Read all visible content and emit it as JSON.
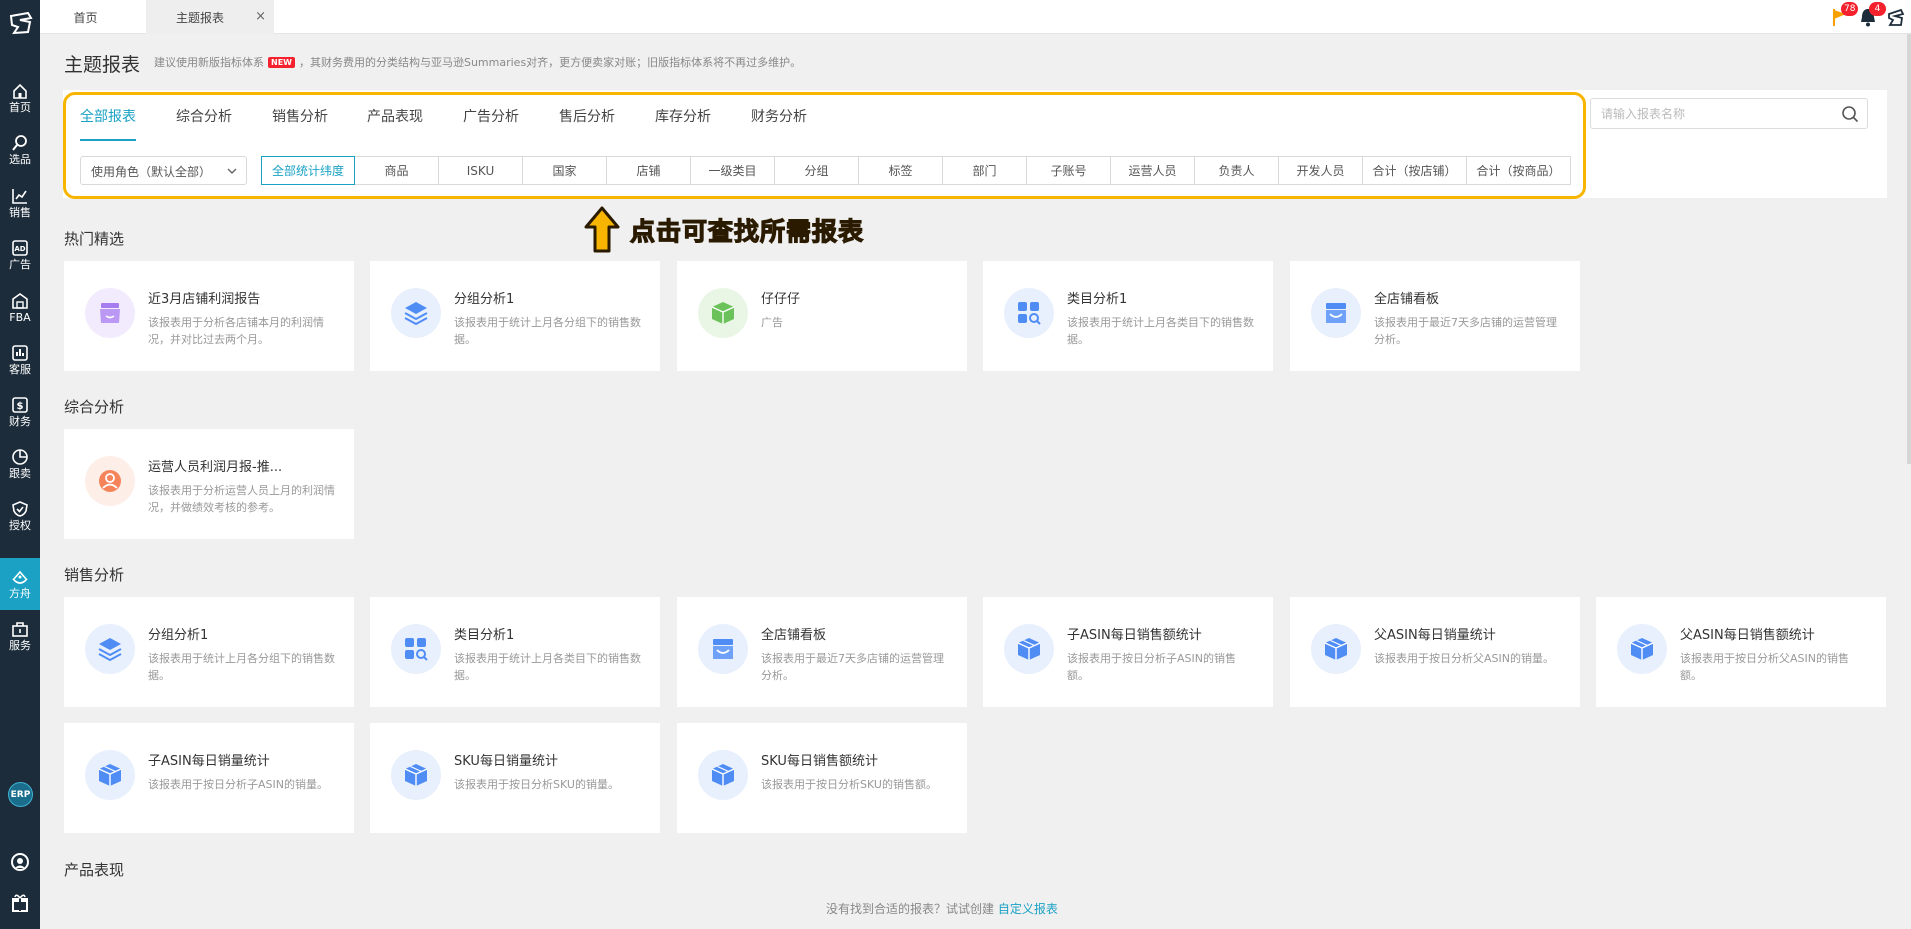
{
  "top_tabs": {
    "home": "首页",
    "active": "主题报表",
    "close": "×"
  },
  "notifications": {
    "flag_count": "78",
    "bell_count": "4"
  },
  "sidebar": {
    "items": [
      {
        "label": "首页",
        "icon": "home-icon"
      },
      {
        "label": "选品",
        "icon": "search-icon"
      },
      {
        "label": "销售",
        "icon": "trend-chart-icon"
      },
      {
        "label": "广告",
        "icon": "ad-icon"
      },
      {
        "label": "FBA",
        "icon": "warehouse-icon"
      },
      {
        "label": "客服",
        "icon": "bar-chart-icon"
      },
      {
        "label": "财务",
        "icon": "dollar-icon"
      },
      {
        "label": "跟卖",
        "icon": "pie-chart-icon"
      },
      {
        "label": "授权",
        "icon": "shield-icon"
      },
      {
        "label": "方舟",
        "icon": "ark-icon"
      },
      {
        "label": "服务",
        "icon": "service-icon"
      }
    ],
    "erp": "ERP"
  },
  "header": {
    "title": "主题报表",
    "note_prefix": "建议使用新版指标体系",
    "new_tag": "NEW",
    "note_suffix": "，其财务费用的分类结构与亚马逊Summaries对齐，更方便卖家对账；旧版指标体系将不再过多维护。"
  },
  "category_tabs": [
    "全部报表",
    "综合分析",
    "销售分析",
    "产品表现",
    "广告分析",
    "售后分析",
    "库存分析",
    "财务分析"
  ],
  "search": {
    "placeholder": "请输入报表名称"
  },
  "role_select": {
    "value": "使用角色（默认全部）"
  },
  "dimensions": [
    "全部统计纬度",
    "商品",
    "ISKU",
    "国家",
    "店铺",
    "一级类目",
    "分组",
    "标签",
    "部门",
    "子账号",
    "运营人员",
    "负责人",
    "开发人员",
    "合计（按店铺）",
    "合计（按商品）"
  ],
  "annotation": "点击可查找所需报表",
  "sections": {
    "hot": {
      "title": "热门精选",
      "cards": [
        {
          "title": "近3月店铺利润报告",
          "desc": "该报表用于分析各店铺本月的利润情况，并对比过去两个月。",
          "icon": "store-icon",
          "color": "#a77cf0",
          "bg": "#f1ebfd"
        },
        {
          "title": "分组分析1",
          "desc": "该报表用于统计上月各分组下的销售数据。",
          "icon": "layers-icon",
          "color": "#4f8df5",
          "bg": "#e8f0fd"
        },
        {
          "title": "仔仔仔",
          "desc": "广告",
          "icon": "box-icon",
          "color": "#6cc25a",
          "bg": "#e9f6e5"
        },
        {
          "title": "类目分析1",
          "desc": "该报表用于统计上月各类目下的销售数据。",
          "icon": "category-search-icon",
          "color": "#4f8df5",
          "bg": "#e8f0fd"
        },
        {
          "title": "全店铺看板",
          "desc": "该报表用于最近7天多店铺的运营管理分析。",
          "icon": "shop-board-icon",
          "color": "#4f8df5",
          "bg": "#e8f0fd"
        }
      ]
    },
    "comprehensive": {
      "title": "综合分析",
      "cards": [
        {
          "title": "运营人员利润月报-推...",
          "desc": "该报表用于分析运营人员上月的利润情况，并做绩效考核的参考。",
          "icon": "person-icon",
          "color": "#f5845a",
          "bg": "#fdeee8"
        }
      ]
    },
    "sales": {
      "title": "销售分析",
      "cards": [
        {
          "title": "分组分析1",
          "desc": "该报表用于统计上月各分组下的销售数据。",
          "icon": "layers-icon",
          "color": "#4f8df5",
          "bg": "#e8f0fd"
        },
        {
          "title": "类目分析1",
          "desc": "该报表用于统计上月各类目下的销售数据。",
          "icon": "category-search-icon",
          "color": "#4f8df5",
          "bg": "#e8f0fd"
        },
        {
          "title": "全店铺看板",
          "desc": "该报表用于最近7天多店铺的运营管理分析。",
          "icon": "shop-board-icon",
          "color": "#4f8df5",
          "bg": "#e8f0fd"
        },
        {
          "title": "子ASIN每日销售额统计",
          "desc": "该报表用于按日分析子ASIN的销售额。",
          "icon": "cube-icon",
          "color": "#4f8df5",
          "bg": "#e8f0fd"
        },
        {
          "title": "父ASIN每日销量统计",
          "desc": "该报表用于按日分析父ASIN的销量。",
          "icon": "cube-icon",
          "color": "#4f8df5",
          "bg": "#e8f0fd"
        },
        {
          "title": "父ASIN每日销售额统计",
          "desc": "该报表用于按日分析父ASIN的销售额。",
          "icon": "cube-icon",
          "color": "#4f8df5",
          "bg": "#e8f0fd"
        },
        {
          "title": "子ASIN每日销量统计",
          "desc": "该报表用于按日分析子ASIN的销量。",
          "icon": "cube-icon",
          "color": "#4f8df5",
          "bg": "#e8f0fd"
        },
        {
          "title": "SKU每日销量统计",
          "desc": "该报表用于按日分析SKU的销量。",
          "icon": "cube-icon",
          "color": "#4f8df5",
          "bg": "#e8f0fd"
        },
        {
          "title": "SKU每日销售额统计",
          "desc": "该报表用于按日分析SKU的销售额。",
          "icon": "cube-icon",
          "color": "#4f8df5",
          "bg": "#e8f0fd"
        }
      ]
    },
    "product": {
      "title": "产品表现"
    }
  },
  "footer": {
    "hint": "没有找到合适的报表？试试创建",
    "link": "自定义报表"
  },
  "colors": {
    "accent": "#1aa1c4",
    "highlight": "#f7b500",
    "sidebar_bg": "#1d2c3a"
  }
}
